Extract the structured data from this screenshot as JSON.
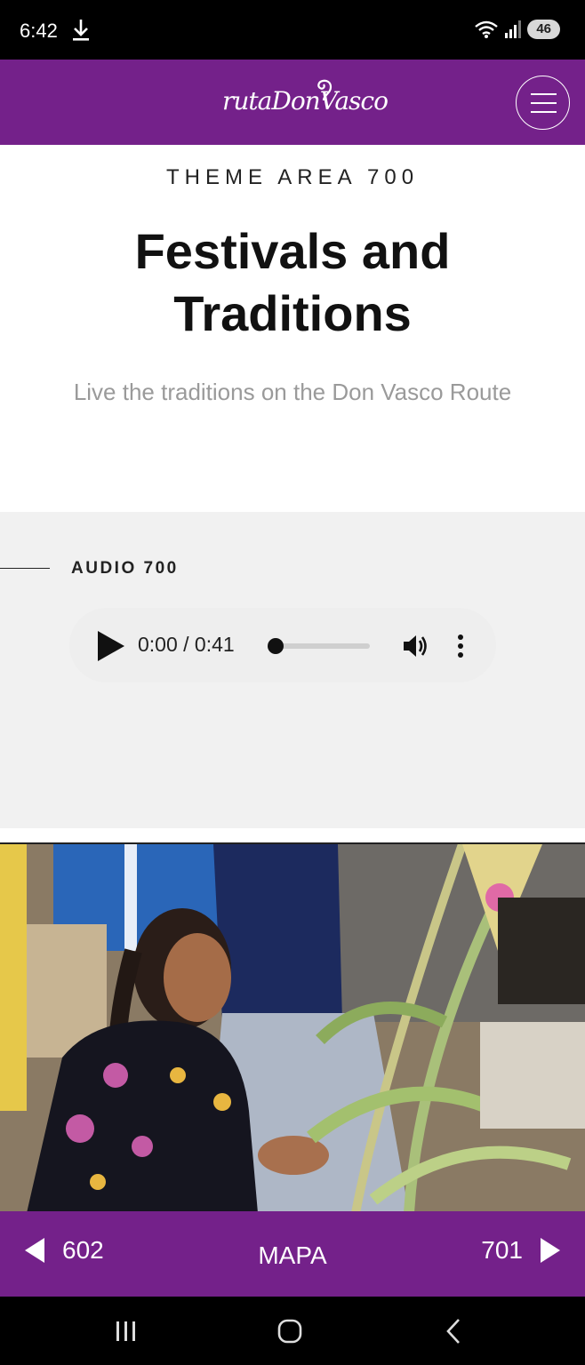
{
  "status_bar": {
    "time": "6:42",
    "battery": "46",
    "icons": [
      "download-icon",
      "wifi-icon",
      "signal-icon",
      "battery-icon"
    ]
  },
  "header": {
    "logo_text": "rutaDonVasco",
    "menu_icon": "hamburger-menu-icon"
  },
  "hero": {
    "theme_area": "THEME AREA 700",
    "title": "Festivals and Traditions",
    "subtitle": "Live the traditions on the Don Vasco Route"
  },
  "audio": {
    "label": "AUDIO 700",
    "time": "0:00 / 0:41",
    "progress": 0.0,
    "icons": [
      "play-icon",
      "volume-icon",
      "more-vertical-icon"
    ]
  },
  "bottom_nav": {
    "prev_label": "602",
    "map_label": "MAPA",
    "next_label": "701"
  },
  "colors": {
    "brand_purple": "#74218a",
    "audio_bg": "#f1f1f1",
    "subtitle_gray": "#9a9a9a"
  }
}
